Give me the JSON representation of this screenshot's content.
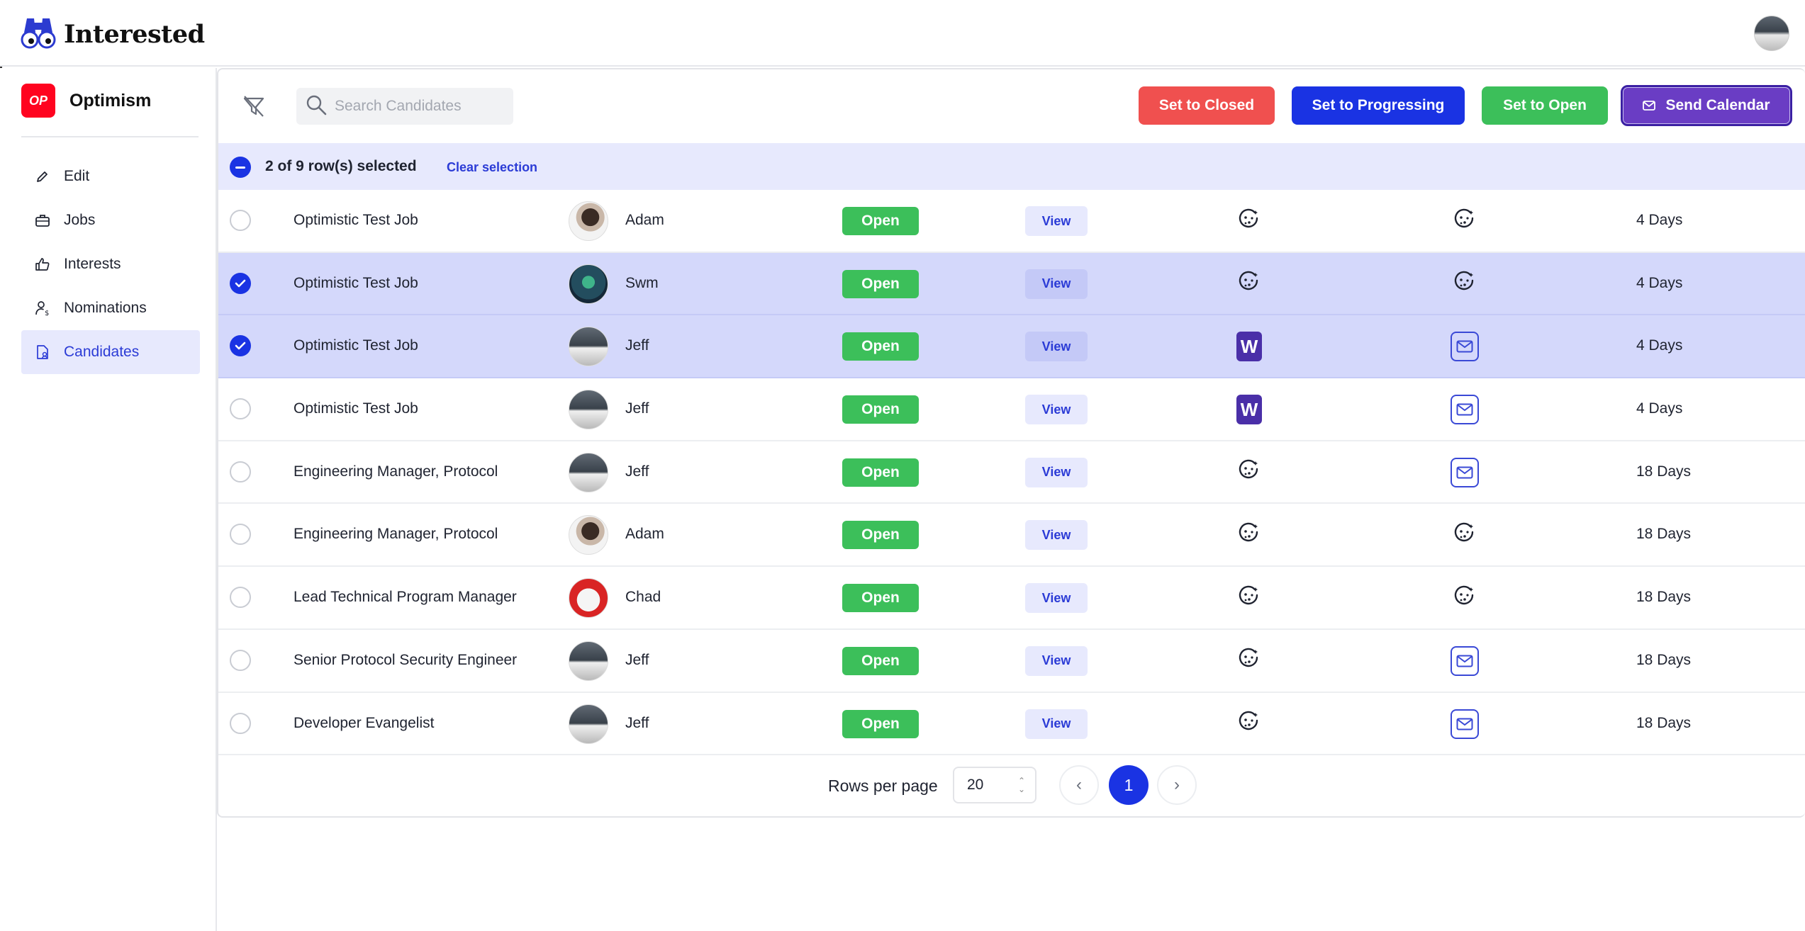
{
  "app": {
    "name": "Interested"
  },
  "org": {
    "name": "Optimism",
    "badge": "OP"
  },
  "sidebar": {
    "items": [
      {
        "label": "Edit",
        "icon": "pencil-icon"
      },
      {
        "label": "Jobs",
        "icon": "briefcase-icon"
      },
      {
        "label": "Interests",
        "icon": "thumbs-up-icon"
      },
      {
        "label": "Nominations",
        "icon": "user-dollar-icon"
      },
      {
        "label": "Candidates",
        "icon": "file-user-icon",
        "active": true
      }
    ]
  },
  "toolbar": {
    "search_placeholder": "Search Candidates",
    "set_closed": "Set to Closed",
    "set_progressing": "Set to Progressing",
    "set_open": "Set to Open",
    "send_calendar": "Send Calendar"
  },
  "selection": {
    "text": "2 of 9 row(s) selected",
    "clear": "Clear selection"
  },
  "rows": [
    {
      "job": "Optimistic Test Job",
      "avatar": "adam",
      "name": "Adam",
      "status": "Open",
      "view": "View",
      "icon_a": "cookie-icon",
      "icon_b": "cookie-icon",
      "days": "4 Days",
      "selected": false
    },
    {
      "job": "Optimistic Test Job",
      "avatar": "swm",
      "name": "Swm",
      "status": "Open",
      "view": "View",
      "icon_a": "cookie-icon",
      "icon_b": "cookie-icon",
      "days": "4 Days",
      "selected": true
    },
    {
      "job": "Optimistic Test Job",
      "avatar": "gray",
      "name": "Jeff",
      "status": "Open",
      "view": "View",
      "icon_a": "w-icon",
      "icon_b": "mail-icon",
      "days": "4 Days",
      "selected": true
    },
    {
      "job": "Optimistic Test Job",
      "avatar": "gray",
      "name": "Jeff",
      "status": "Open",
      "view": "View",
      "icon_a": "w-icon",
      "icon_b": "mail-icon",
      "days": "4 Days",
      "selected": false
    },
    {
      "job": "Engineering Manager, Protocol",
      "avatar": "gray",
      "name": "Jeff",
      "status": "Open",
      "view": "View",
      "icon_a": "cookie-icon",
      "icon_b": "mail-icon",
      "days": "18 Days",
      "selected": false
    },
    {
      "job": "Engineering Manager, Protocol",
      "avatar": "adam",
      "name": "Adam",
      "status": "Open",
      "view": "View",
      "icon_a": "cookie-icon",
      "icon_b": "cookie-icon",
      "days": "18 Days",
      "selected": false
    },
    {
      "job": "Lead Technical Program Manager",
      "avatar": "chad",
      "name": "Chad",
      "status": "Open",
      "view": "View",
      "icon_a": "cookie-icon",
      "icon_b": "cookie-icon",
      "days": "18 Days",
      "selected": false
    },
    {
      "job": "Senior Protocol Security Engineer",
      "avatar": "gray",
      "name": "Jeff",
      "status": "Open",
      "view": "View",
      "icon_a": "cookie-icon",
      "icon_b": "mail-icon",
      "days": "18 Days",
      "selected": false
    },
    {
      "job": "Developer Evangelist",
      "avatar": "gray",
      "name": "Jeff",
      "status": "Open",
      "view": "View",
      "icon_a": "cookie-icon",
      "icon_b": "mail-icon",
      "days": "18 Days",
      "selected": false
    }
  ],
  "pagination": {
    "rows_per_page_label": "Rows per page",
    "rows_per_page": "20",
    "current_page": "1"
  },
  "colors": {
    "accent": "#1a33e3",
    "closed": "#f0504f",
    "open": "#3cbf5a",
    "calendar": "#6a3dc4",
    "selected_row": "#d4d8fb"
  }
}
